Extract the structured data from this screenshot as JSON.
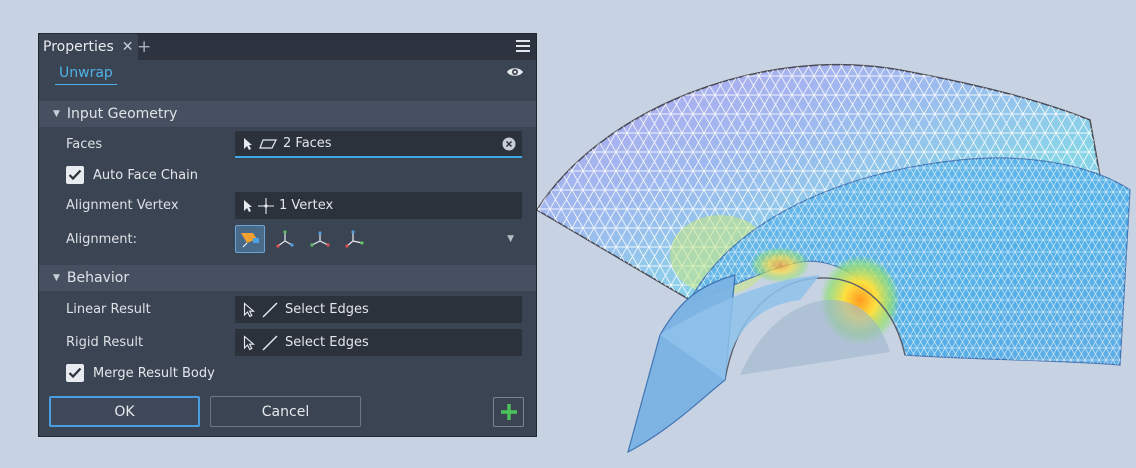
{
  "panel": {
    "tab_label": "Properties",
    "tab_close": "✕",
    "tab_add": "+",
    "command_label": "Unwrap",
    "sections": {
      "input_geometry": {
        "title": "Input Geometry",
        "faces_label": "Faces",
        "faces_value": "2 Faces",
        "auto_face_chain_label": "Auto Face Chain",
        "auto_face_chain_checked": true,
        "alignment_vertex_label": "Alignment Vertex",
        "alignment_vertex_value": "1 Vertex",
        "alignment_label": "Alignment:"
      },
      "behavior": {
        "title": "Behavior",
        "linear_result_label": "Linear Result",
        "linear_result_value": "Select Edges",
        "rigid_result_label": "Rigid Result",
        "rigid_result_value": "Select Edges",
        "merge_result_body_label": "Merge Result Body",
        "merge_result_body_checked": true
      }
    },
    "buttons": {
      "ok": "OK",
      "cancel": "Cancel",
      "add": "+"
    }
  },
  "colors": {
    "panel_bg": "#3b4453",
    "accent": "#4fb2e6",
    "add_green": "#4cc35a",
    "viewport_bg": "#c7d3e3",
    "mesh_blue": "#7fb6e8"
  },
  "icons": [
    "close-icon",
    "plus-icon",
    "hamburger-menu-icon",
    "eye-icon",
    "cursor-arrow-icon",
    "face-icon",
    "vertex-icon",
    "edge-icon",
    "clear-icon",
    "check-icon"
  ]
}
